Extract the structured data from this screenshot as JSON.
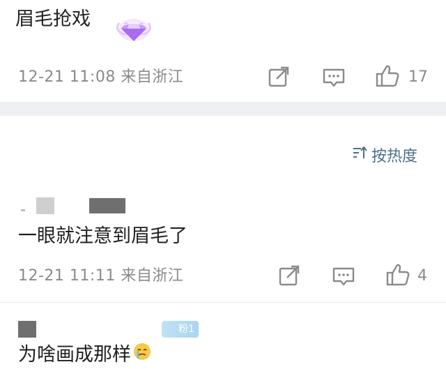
{
  "top_comment": {
    "text": "眉毛抢戏",
    "time": "12-21 11:08 来自浙江",
    "like_count": "17"
  },
  "sort": {
    "label": "按热度"
  },
  "comment_2": {
    "text": "一眼就注意到眉毛了",
    "time": "12-21 11:11 来自浙江",
    "like_count": "4"
  },
  "comment_3": {
    "fan_badge": "粉1",
    "text": "为啥画成那样"
  },
  "icons": {
    "share": "share-icon",
    "comment": "comment-icon",
    "like": "thumbs-up-icon",
    "sort": "sort-icon",
    "badge": "diamond-badge-icon"
  },
  "colors": {
    "meta": "#8a8a8a",
    "sort_accent": "#4a6f8a",
    "band": "#eef0f3"
  }
}
